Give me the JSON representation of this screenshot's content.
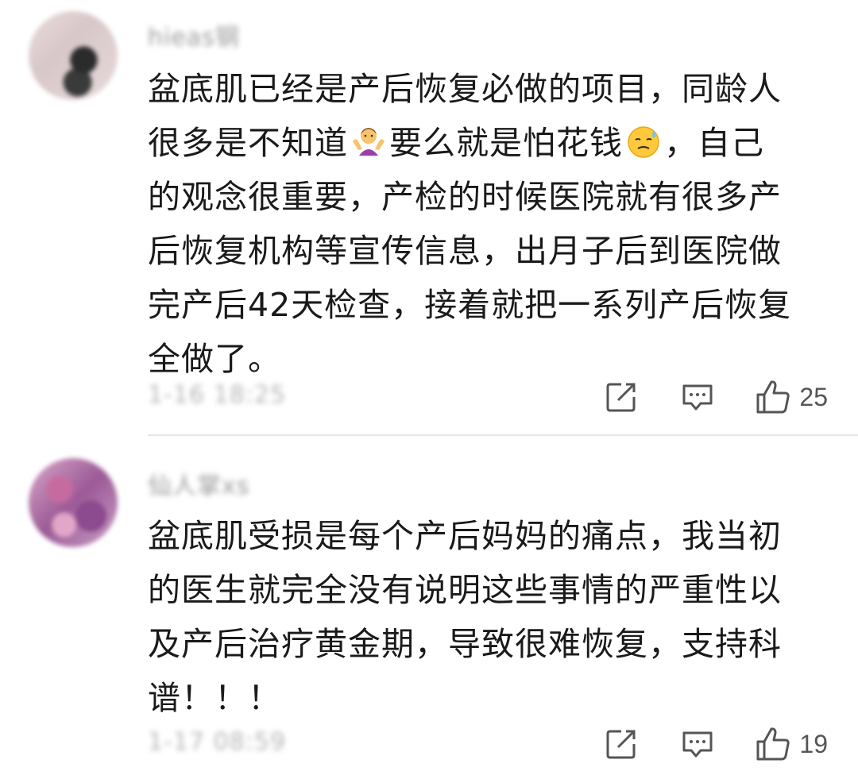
{
  "comments": [
    {
      "username": "hieas钢",
      "body_lines": [
        "盆底肌已经是产后恢复必做的项目，同龄人",
        "很多是不知道",
        "要么就是怕花钱",
        "，自己",
        "的观念很重要，产检的时候医院就有很多产",
        "后恢复机构等宣传信息，出月子后到医院做",
        "完产后42天检查，接着就把一系列产后恢复",
        "全做了。"
      ],
      "emoji_1": "woman-shrugging-emoji",
      "emoji_2": "sad-sweat-face-emoji",
      "timestamp": "1-16 18:25",
      "like_count": "25"
    },
    {
      "username": "仙人掌xs",
      "body_lines": [
        "盆底肌受损是每个产后妈妈的痛点，我当初",
        "的医生就完全没有说明这些事情的严重性以",
        "及产后治疗黄金期，导致很难恢复，支持科",
        "谱！！！"
      ],
      "timestamp": "1-17 08:59",
      "like_count": "19"
    }
  ],
  "icons": {
    "share": "share-icon",
    "reply": "comment-icon",
    "like": "thumbs-up-icon"
  },
  "colors": {
    "text": "#1a1a1a",
    "muted": "#9a9a9a",
    "icon": "#555555",
    "divider": "#e6e6e6"
  }
}
